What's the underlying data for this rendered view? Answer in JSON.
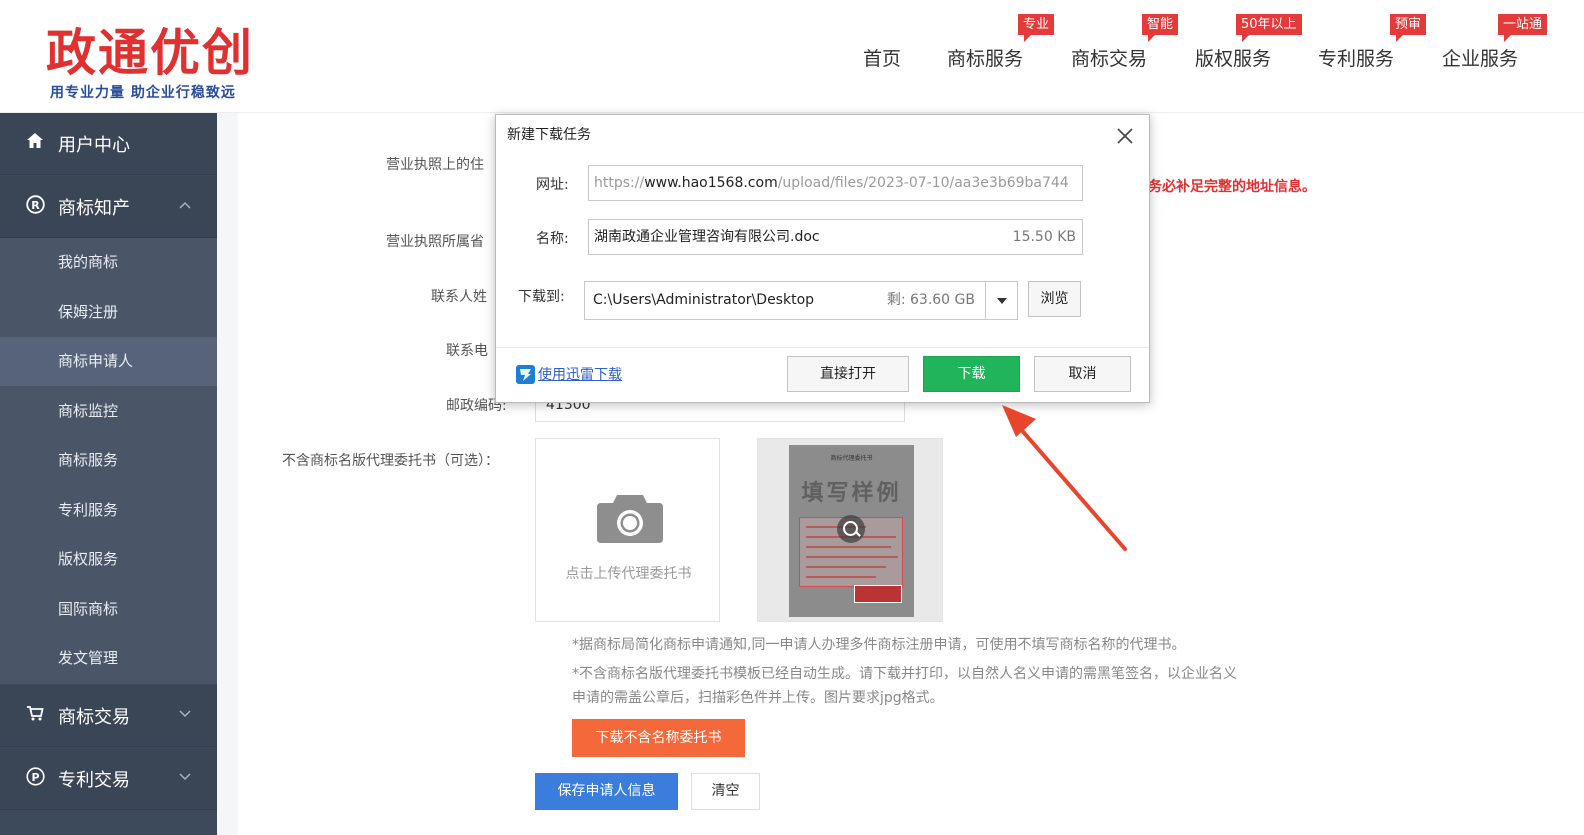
{
  "header": {
    "logo_text": "政通优创",
    "logo_slogan": "用专业力量 助企业行稳致远",
    "nav": [
      {
        "label": "首页",
        "badge": ""
      },
      {
        "label": "商标服务",
        "badge": "专业"
      },
      {
        "label": "商标交易",
        "badge": "智能"
      },
      {
        "label": "版权服务",
        "badge": "50年以上"
      },
      {
        "label": "专利服务",
        "badge": "预审"
      },
      {
        "label": "企业服务",
        "badge": "一站通"
      }
    ]
  },
  "sidebar": {
    "user_center": "用户中心",
    "trademark_ip": "商标知产",
    "sub_items": [
      "我的商标",
      "保姆注册",
      "商标申请人",
      "商标监控",
      "商标服务",
      "专利服务",
      "版权服务",
      "国际商标",
      "发文管理"
    ],
    "active_sub": "商标申请人",
    "trademark_trade": "商标交易",
    "patent_trade": "专利交易",
    "colors": {
      "bg": "#3d4a5c",
      "active": "#56637a"
    }
  },
  "form": {
    "label_address": "营业执照上的住",
    "label_region": "营业执照所属省",
    "label_contact": "联系人姓",
    "label_phone": "联系电",
    "label_zip": "邮政编码:",
    "zip_value": "41300",
    "red_tip": "务必补足完整的地址信息。",
    "label_proxy": "不含商标名版代理委托书（可选）：",
    "upload_text": "点击上传代理委托书",
    "sample_title": "商标代理委托书",
    "sample_watermark": "填写样例",
    "note_1": "*据商标局简化商标申请通知,同一申请人办理多件商标注册申请，可使用不填写商标名称的代理书。",
    "note_2a": "*不含商标名版代理委托书模板已经自动生成。请下载并打印，以自然人名义申请的需黑笔签名，以企业名义",
    "note_2b": "申请的需盖公章后，扫描彩色件并上传。图片要求jpg格式。",
    "download_btn": "下载不含名称委托书",
    "save_btn": "保存申请人信息",
    "clear_btn": "清空"
  },
  "dialog": {
    "title": "新建下载任务",
    "url_label": "网址:",
    "url_prefix": "https://",
    "url_host": "www.hao1568.com",
    "url_path": "/upload/files/2023-07-10/aa3e3b69ba744",
    "name_label": "名称:",
    "file_name": "湖南政通企业管理咨询有限公司.doc",
    "file_size": "15.50 KB",
    "save_label": "下载到:",
    "save_path": "C:\\Users\\Administrator\\Desktop",
    "free_space": "剩: 63.60 GB",
    "browse_btn": "浏览",
    "thunder_link": "使用迅雷下载",
    "open_btn": "直接打开",
    "download_btn": "下载",
    "cancel_btn": "取消",
    "colors": {
      "download_green": "#21b55b",
      "link_blue": "#2e62c7"
    }
  },
  "annotation": {
    "arrow_color": "#e8452c"
  }
}
